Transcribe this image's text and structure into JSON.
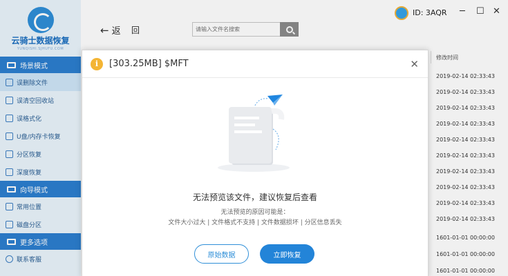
{
  "app": {
    "name": "云骑士数据恢复",
    "subtitle": "YUNQISHI.SJHUFU.COM"
  },
  "user": {
    "id_label": "ID: 3AQR"
  },
  "window": {
    "minimize": "─",
    "maximize": "☐",
    "close": "✕"
  },
  "nav": {
    "back_arrow": "←",
    "back_label": "返",
    "home_label": "回"
  },
  "search": {
    "placeholder": "请输入文件名搜索"
  },
  "sidebar": {
    "sections": [
      {
        "label": "场景模式",
        "items": [
          "误删除文件",
          "误清空回收站",
          "误格式化",
          "U盘/内存卡恢复",
          "分区恢复",
          "深度恢复"
        ]
      },
      {
        "label": "向导模式",
        "items": [
          "常用位置",
          "磁盘分区"
        ]
      },
      {
        "label": "更多选项",
        "items": [
          "联系客服"
        ]
      }
    ]
  },
  "list": {
    "column_header": "修改时间",
    "times": [
      "2019-02-14 02:33:43",
      "2019-02-14 02:33:43",
      "2019-02-14 02:33:43",
      "2019-02-14 02:33:43",
      "2019-02-14 02:33:43",
      "2019-02-14 02:33:43",
      "2019-02-14 02:33:43",
      "2019-02-14 02:33:43",
      "2019-02-14 02:33:43",
      "2019-02-14 02:33:43",
      "1601-01-01 00:00:00",
      "1601-01-01 00:00:00",
      "1601-01-01 00:00:00"
    ]
  },
  "dialog": {
    "icon": "i",
    "title": "[303.25MB] $MFT",
    "close": "✕",
    "message": "无法预览该文件，建议恢复后查看",
    "reason_title": "无法预览的原因可能是：",
    "reasons": "文件大小过大 | 文件格式不支持 | 文件数据损坏 | 分区信息丢失",
    "btn_raw": "原始数据",
    "btn_recover": "立即恢复"
  },
  "colors": {
    "accent": "#2384d8",
    "section_bg": "#2c7fd0",
    "info": "#f4b534"
  }
}
